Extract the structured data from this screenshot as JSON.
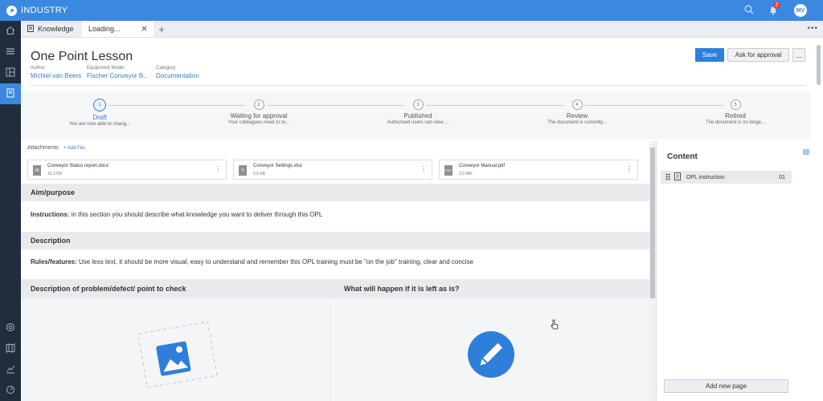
{
  "app": {
    "brand": "INDUSTRY",
    "notifications": "2",
    "user_initials": "MV"
  },
  "tabs": [
    {
      "label": "Knowledge"
    },
    {
      "label": "Loading..."
    }
  ],
  "header": {
    "title": "One Point Lesson",
    "author_label": "Author",
    "author": "Michiel van Beers",
    "equipment_label": "Equipment Model",
    "equipment": "Fischer Conveyor B...",
    "category_label": "Category",
    "category": "Documentation",
    "save": "Save",
    "ask_approval": "Ask for approval",
    "more": "..."
  },
  "steps": [
    {
      "num": "1",
      "name": "Draft",
      "desc": "You are now able to chang..."
    },
    {
      "num": "2",
      "name": "Waiting for approval",
      "desc": "Your colleagues need to re..."
    },
    {
      "num": "3",
      "name": "Published",
      "desc": "Authorised users can view ..."
    },
    {
      "num": "4",
      "name": "Review",
      "desc": "The document is currently..."
    },
    {
      "num": "5",
      "name": "Retired",
      "desc": "The document is no longe..."
    }
  ],
  "attachments": {
    "label": "Attachments",
    "add": "+ Add File",
    "files": [
      {
        "name": "Conveyor Status report.docx",
        "size": "15.3 KB",
        "type": "W"
      },
      {
        "name": "Conveyor Settings.xlsx",
        "size": "9.6 KB",
        "type": "X"
      },
      {
        "name": "Conveyor Manual.pdf",
        "size": "2.0 MB",
        "type": "PDF"
      }
    ]
  },
  "sections": {
    "aim_title": "Aim/purpose",
    "aim_label": "Instructions:",
    "aim_text": " in this section you should describe what knowledge you want to deliver through this OPL",
    "desc_title": "Description",
    "desc_label": "Rules/features:",
    "desc_text": " Use less text, it should be more visual, easy to understand and remember this OPL training must be \"on the job\" training, clear and concise",
    "problem_title": "Description of problem/defect/ point to check",
    "happen_title": "What will happen if it is left as is?"
  },
  "content_panel": {
    "title": "Content",
    "item": "OPL instruction",
    "item_num": "01",
    "add_page": "Add new page"
  },
  "colors": {
    "topbar": "#3a88e0",
    "rail": "#1f2d3d",
    "accent": "#2e7fd9"
  }
}
